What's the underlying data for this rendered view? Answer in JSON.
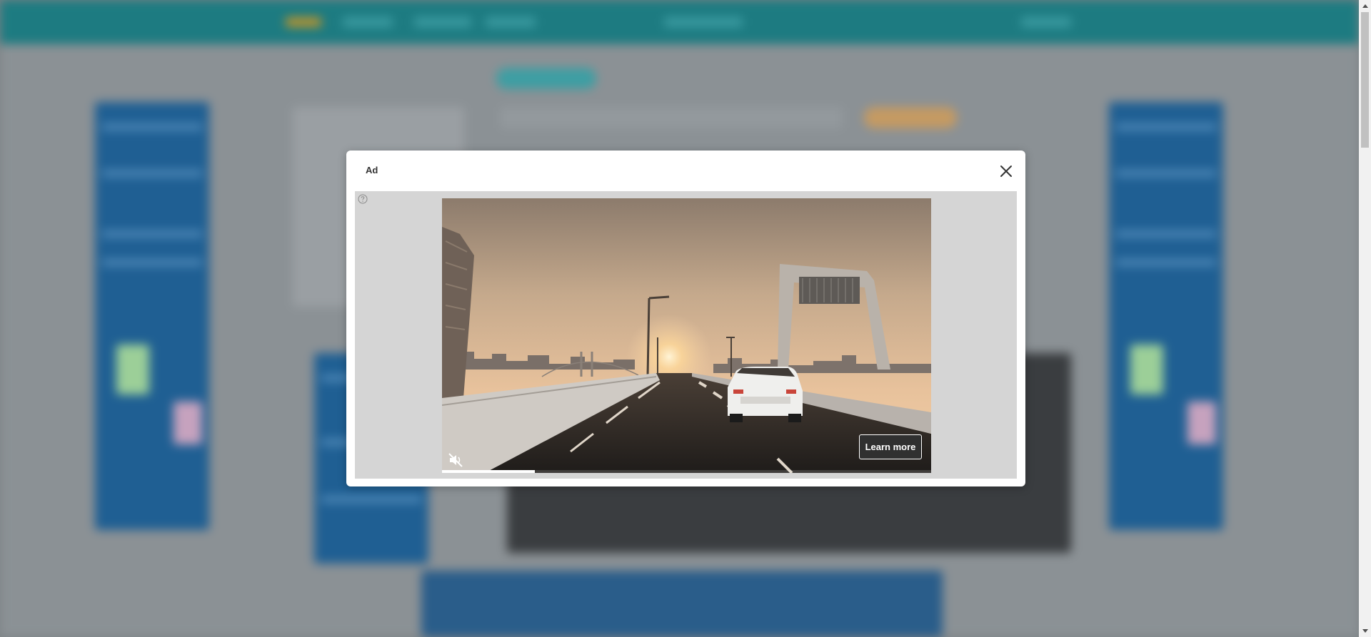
{
  "modal": {
    "label": "Ad",
    "close_icon": "close-icon",
    "help_icon": "help-circle-icon",
    "learn_more_label": "Learn more",
    "mute_icon": "muted-speaker-icon",
    "video_progress": 0.19
  },
  "colors": {
    "topbar": "#1d7b81",
    "overlay": "#8b9195",
    "modal_bg": "#ffffff",
    "ad_frame_bg": "#d5d5d5",
    "button_bg": "#303030"
  }
}
